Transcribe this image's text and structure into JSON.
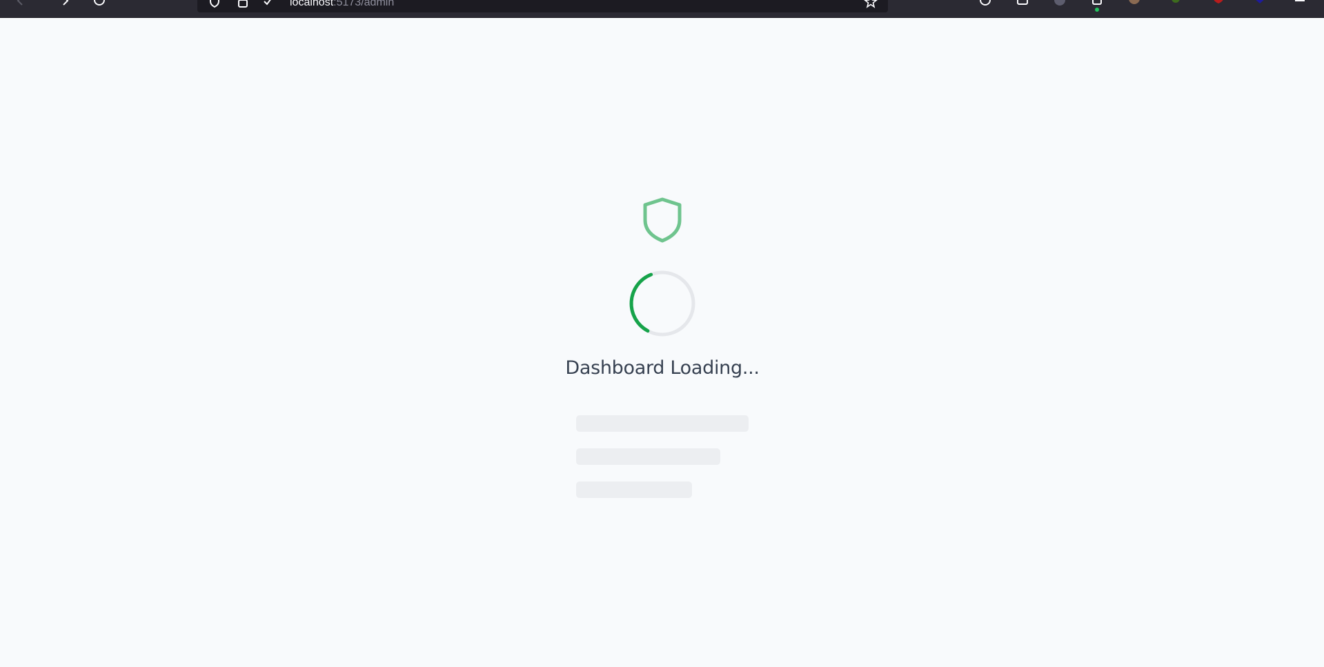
{
  "browser": {
    "url_host": "localhost",
    "url_path": ":5173/admin",
    "extension_dot_color": "#22c55e"
  },
  "loader": {
    "icon": "shield-icon",
    "spinner": "spinner",
    "message": "Dashboard Loading...",
    "accent_color": "#16a34a",
    "shield_color": "#6fc48e",
    "skeleton_lines": 3
  }
}
